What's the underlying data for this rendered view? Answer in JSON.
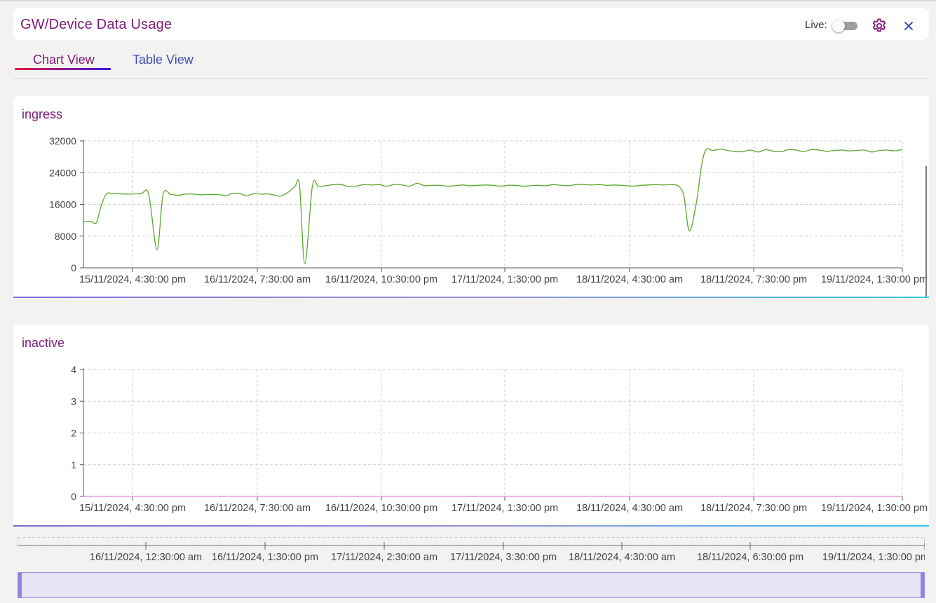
{
  "header": {
    "title": "GW/Device Data Usage",
    "live_label": "Live:",
    "live_enabled": false,
    "icons": [
      "gear-icon",
      "close-icon"
    ]
  },
  "tabs": [
    {
      "label": "Chart View",
      "active": true
    },
    {
      "label": "Table View",
      "active": false
    }
  ],
  "colors": {
    "accent": "#7b1a78",
    "ingress_line": "#5aa82c",
    "inactive_line": "#e38ae0",
    "tab_active_from": "#e3173e",
    "tab_active_to": "#3a16e0"
  },
  "chart_data": [
    {
      "type": "line",
      "title": "ingress",
      "x_ticks": [
        "15/11/2024, 4:30:00 pm",
        "16/11/2024, 7:30:00 am",
        "16/11/2024, 10:30:00 pm",
        "17/11/2024, 1:30:00 pm",
        "18/11/2024, 4:30:00 am",
        "18/11/2024, 7:30:00 pm",
        "19/11/2024, 1:30:00 pm"
      ],
      "y_ticks": [
        0,
        8000,
        16000,
        24000,
        32000
      ],
      "ylim": [
        0,
        32000
      ],
      "grid": true,
      "series": [
        {
          "color": "#5aa82c",
          "points": [
            [
              0.0,
              11600
            ],
            [
              1.0,
              11700
            ],
            [
              1.7,
              11400
            ],
            [
              2.4,
              16000
            ],
            [
              3.1,
              18700
            ],
            [
              4.0,
              18700
            ],
            [
              6.0,
              18600
            ],
            [
              7.6,
              18700
            ],
            [
              8.6,
              18600
            ],
            [
              9.7,
              4600
            ],
            [
              10.5,
              18500
            ],
            [
              11.5,
              18500
            ],
            [
              12.5,
              18300
            ],
            [
              13.5,
              18600
            ],
            [
              14.5,
              18600
            ],
            [
              15.5,
              18400
            ],
            [
              16.5,
              18500
            ],
            [
              17.5,
              18500
            ],
            [
              18.5,
              18300
            ],
            [
              19.0,
              18200
            ],
            [
              19.5,
              18700
            ],
            [
              20.5,
              18800
            ],
            [
              21.5,
              18200
            ],
            [
              22.5,
              18700
            ],
            [
              23.5,
              18600
            ],
            [
              24.5,
              18600
            ],
            [
              25.5,
              18200
            ],
            [
              26.0,
              18100
            ],
            [
              26.6,
              18600
            ],
            [
              27.3,
              19500
            ],
            [
              27.9,
              20500
            ],
            [
              28.5,
              20800
            ],
            [
              29.2,
              1000
            ],
            [
              30.2,
              20700
            ],
            [
              31.0,
              20500
            ],
            [
              32.0,
              20700
            ],
            [
              33.0,
              21000
            ],
            [
              34.0,
              21000
            ],
            [
              35.0,
              20500
            ],
            [
              36.0,
              20600
            ],
            [
              37.0,
              21000
            ],
            [
              38.0,
              20900
            ],
            [
              39.0,
              21000
            ],
            [
              40.0,
              20600
            ],
            [
              41.0,
              21000
            ],
            [
              42.0,
              20900
            ],
            [
              43.0,
              20600
            ],
            [
              44.0,
              21300
            ],
            [
              45.0,
              20700
            ],
            [
              46.0,
              20800
            ],
            [
              47.0,
              20800
            ],
            [
              48.0,
              20600
            ],
            [
              49.0,
              20700
            ],
            [
              50.0,
              20900
            ],
            [
              51.0,
              20700
            ],
            [
              52.0,
              20800
            ],
            [
              53.0,
              20900
            ],
            [
              54.0,
              20800
            ],
            [
              55.0,
              20600
            ],
            [
              56.0,
              20800
            ],
            [
              57.0,
              20800
            ],
            [
              58.0,
              20600
            ],
            [
              59.0,
              20700
            ],
            [
              60.0,
              20800
            ],
            [
              61.0,
              20700
            ],
            [
              62.0,
              21000
            ],
            [
              63.0,
              20800
            ],
            [
              64.0,
              20700
            ],
            [
              65.0,
              21000
            ],
            [
              66.0,
              21000
            ],
            [
              67.0,
              20900
            ],
            [
              68.0,
              21000
            ],
            [
              69.0,
              20800
            ],
            [
              70.0,
              20900
            ],
            [
              71.0,
              20800
            ],
            [
              72.5,
              20600
            ],
            [
              73.5,
              20800
            ],
            [
              74.5,
              20900
            ],
            [
              75.5,
              21000
            ],
            [
              76.5,
              20900
            ],
            [
              77.5,
              21000
            ],
            [
              78.5,
              20600
            ],
            [
              79.2,
              18000
            ],
            [
              79.9,
              9300
            ],
            [
              80.8,
              16000
            ],
            [
              81.5,
              25500
            ],
            [
              82.1,
              29800
            ],
            [
              83.0,
              29600
            ],
            [
              84.0,
              29900
            ],
            [
              85.0,
              29600
            ],
            [
              86.0,
              29300
            ],
            [
              87.0,
              29300
            ],
            [
              88.0,
              29700
            ],
            [
              89.0,
              29200
            ],
            [
              90.0,
              29800
            ],
            [
              91.0,
              29400
            ],
            [
              92.0,
              29300
            ],
            [
              93.0,
              29800
            ],
            [
              94.0,
              29700
            ],
            [
              95.0,
              29300
            ],
            [
              96.0,
              29800
            ],
            [
              97.0,
              29700
            ],
            [
              98.0,
              29400
            ],
            [
              99.0,
              29600
            ],
            [
              100.0,
              29700
            ],
            [
              101.0,
              29500
            ],
            [
              102.0,
              29600
            ],
            [
              103.0,
              29700
            ],
            [
              104.0,
              29200
            ],
            [
              105.0,
              29600
            ],
            [
              106.0,
              29700
            ],
            [
              107.0,
              29500
            ],
            [
              108.0,
              29800
            ]
          ]
        }
      ]
    },
    {
      "type": "line",
      "title": "inactive",
      "x_ticks": [
        "15/11/2024, 4:30:00 pm",
        "16/11/2024, 7:30:00 am",
        "16/11/2024, 10:30:00 pm",
        "17/11/2024, 1:30:00 pm",
        "18/11/2024, 4:30:00 am",
        "18/11/2024, 7:30:00 pm",
        "19/11/2024, 1:30:00 pm"
      ],
      "y_ticks": [
        0,
        1,
        2,
        3,
        4
      ],
      "ylim": [
        0,
        4
      ],
      "grid": true,
      "series": [
        {
          "color": "#e38ae0",
          "points": [
            [
              0.0,
              0
            ],
            [
              108.0,
              0
            ]
          ]
        }
      ]
    }
  ],
  "navigator": {
    "ticks": [
      "16/11/2024, 12:30:00 am",
      "16/11/2024, 1:30:00 pm",
      "17/11/2024, 2:30:00 am",
      "17/11/2024, 3:30:00 pm",
      "18/11/2024, 4:30:00 am",
      "18/11/2024, 6:30:00 pm",
      "19/11/2024, 1:30:00 pm"
    ]
  }
}
